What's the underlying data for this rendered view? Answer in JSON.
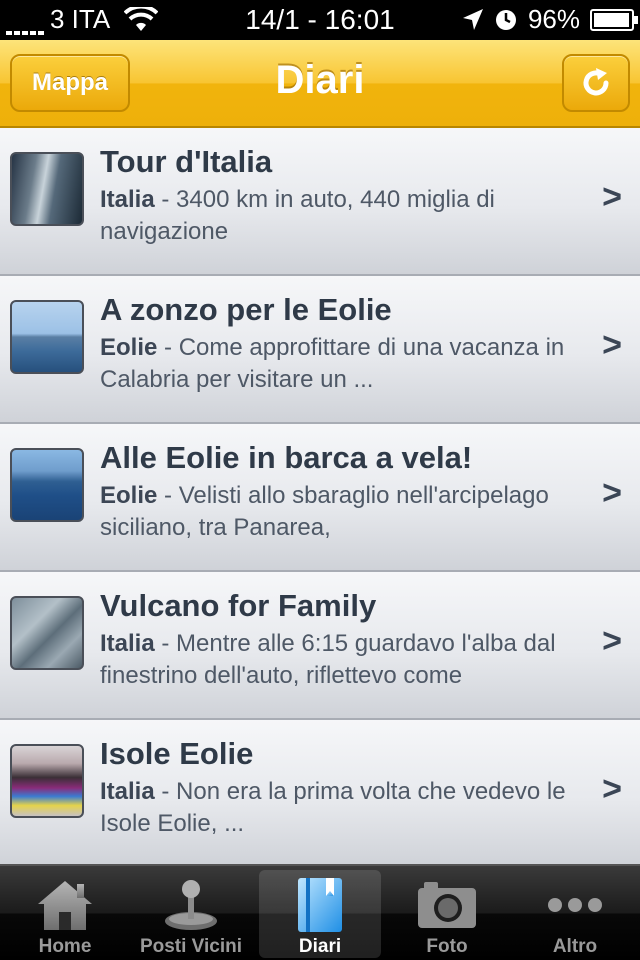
{
  "status": {
    "carrier": "3 ITA",
    "time": "14/1 - 16:01",
    "battery": "96%",
    "battery_level": 0.96
  },
  "nav": {
    "left_button": "Mappa",
    "title": "Diari",
    "right_icon": "refresh-icon"
  },
  "diaries": [
    {
      "title": "Tour d'Italia",
      "place": "Italia",
      "desc": " - 3400 km in auto, 440 miglia di navigazione"
    },
    {
      "title": "A zonzo per le Eolie",
      "place": "Eolie",
      "desc": " - Come approfittare di una vacanza in Calabria per visitare un ..."
    },
    {
      "title": "Alle Eolie in barca a vela!",
      "place": "Eolie",
      "desc": " - Velisti allo sbaraglio nell'arcipelago siciliano, tra Panarea,"
    },
    {
      "title": "Vulcano for Family",
      "place": "Italia",
      "desc": " - Mentre alle 6:15 guardavo l'alba dal finestrino dell'auto, riflettevo come"
    },
    {
      "title": "Isole Eolie",
      "place": "Italia",
      "desc": " - Non era la prima volta che vedevo le Isole Eolie, ..."
    }
  ],
  "chevron": ">",
  "tabs": [
    {
      "label": "Home",
      "icon": "house-icon"
    },
    {
      "label": "Posti Vicini",
      "icon": "joystick-icon"
    },
    {
      "label": "Diari",
      "icon": "book-icon",
      "active": true
    },
    {
      "label": "Foto",
      "icon": "camera-icon"
    },
    {
      "label": "Altro",
      "icon": "more-icon"
    }
  ],
  "colors": {
    "nav_accent": "#f1b40d",
    "text_title": "#2f3a48"
  }
}
